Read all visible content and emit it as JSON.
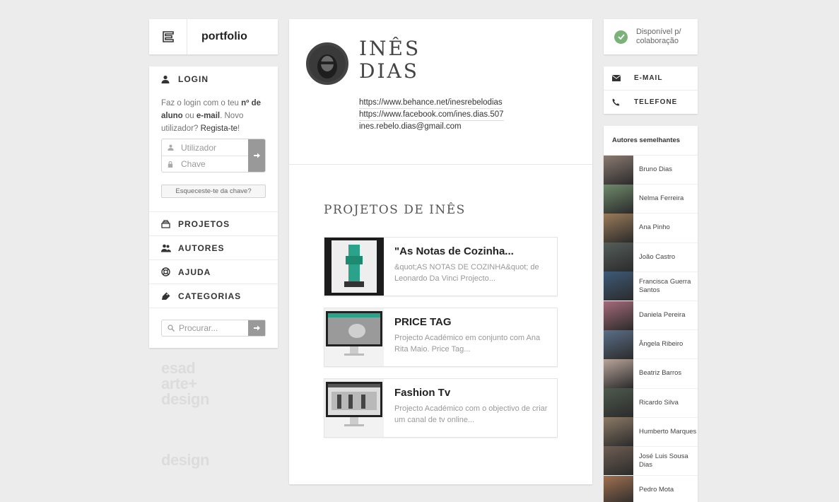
{
  "brand": {
    "logo_text": "portfolio"
  },
  "login": {
    "heading": "LOGIN",
    "desc_1": "Faz o login com o teu ",
    "desc_bold1": "nº de aluno",
    "desc_2": " ou ",
    "desc_bold2": "e-mail",
    "desc_3": ". Novo utilizador? ",
    "desc_link": "Regista-te",
    "desc_4": "!",
    "user_placeholder": "Utilizador",
    "pass_placeholder": "Chave",
    "forgot": "Esqueceste-te da chave?"
  },
  "nav": {
    "items": [
      {
        "label": "PROJETOS",
        "icon": "projects-icon"
      },
      {
        "label": "AUTORES",
        "icon": "users-icon"
      },
      {
        "label": "AJUDA",
        "icon": "help-icon"
      },
      {
        "label": "CATEGORIAS",
        "icon": "tag-icon"
      }
    ],
    "search_placeholder": "Procurar..."
  },
  "school": {
    "line1": "esad",
    "line2": "arte+",
    "line3": "design",
    "line4": "design"
  },
  "profile": {
    "first_name": "INÊS",
    "last_name": "DIAS",
    "link_behance": "https://www.behance.net/inesrebelodias",
    "link_facebook": "https://www.facebook.com/ines.dias.507",
    "email": "ines.rebelo.dias@gmail.com"
  },
  "projects": {
    "title": "PROJETOS DE INÊS",
    "items": [
      {
        "name": "\"As Notas de Cozinha...",
        "desc": "&quot;AS NOTAS DE COZINHA&quot; de Leonardo Da Vinci Projecto..."
      },
      {
        "name": "PRICE TAG",
        "desc": "Projecto Académico em conjunto com Ana Rita Maio. Price Tag..."
      },
      {
        "name": "Fashion Tv",
        "desc": "Projecto Académico com o objectivo de criar um canal de tv online..."
      }
    ]
  },
  "status": {
    "line1": "Disponível p/",
    "line2": "colaboração",
    "color": "#7ab37a"
  },
  "contact": {
    "email": "E-MAIL",
    "phone": "TELEFONE"
  },
  "authors": {
    "heading": "Autores semelhantes",
    "items": [
      "Bruno Dias",
      "Nelma Ferreira",
      "Ana Pinho",
      "João Castro",
      "Francisca Guerra Santos",
      "Daniela Pereira",
      "Ângela Ribeiro",
      "Beatriz Barros",
      "Ricardo Silva",
      "Humberto Marques",
      "José Luis Sousa Dias",
      "Pedro Mota"
    ]
  }
}
